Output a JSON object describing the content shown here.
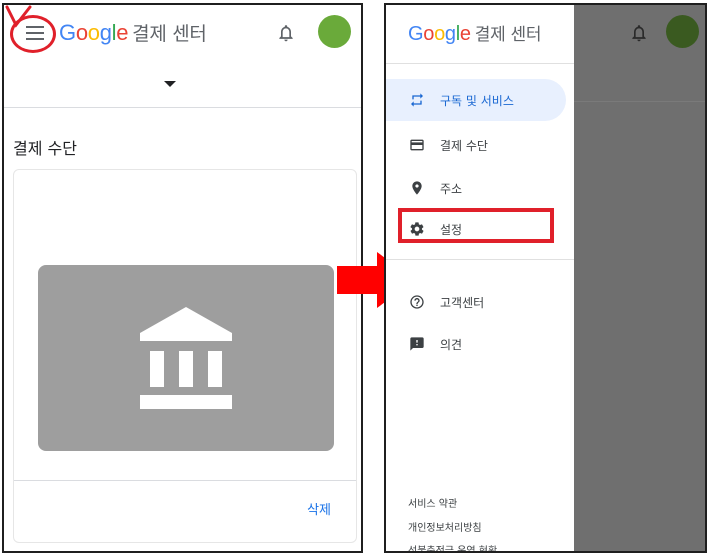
{
  "app_name": "결제 센터",
  "logo_letters": [
    "G",
    "o",
    "o",
    "g",
    "l",
    "e"
  ],
  "left_screen": {
    "section_title": "결제 수단",
    "delete_label": "삭제"
  },
  "right_screen": {
    "menu_items": [
      {
        "label": "구독 및 서비스",
        "icon": "sync-arrows-icon",
        "active": true
      },
      {
        "label": "결제 수단",
        "icon": "credit-card-icon",
        "active": false
      },
      {
        "label": "주소",
        "icon": "location-pin-icon",
        "active": false
      },
      {
        "label": "설정",
        "icon": "gear-icon",
        "active": false
      },
      {
        "label": "고객센터",
        "icon": "help-circle-icon",
        "active": false
      },
      {
        "label": "의견",
        "icon": "feedback-icon",
        "active": false
      }
    ],
    "footer_links": [
      "서비스 약관",
      "개인정보처리방침",
      "선불충전금 운영 현황"
    ]
  },
  "colors": {
    "annotation_red": "#e0202a",
    "active_bg": "#e8f0fe",
    "active_text": "#1967d2",
    "avatar_green": "#6aaa3a",
    "avatar_green_dim": "#3a5a20",
    "bank_tile": "#9e9e9e",
    "link_blue": "#1a73e8",
    "scrim": "#6f6f6f"
  }
}
